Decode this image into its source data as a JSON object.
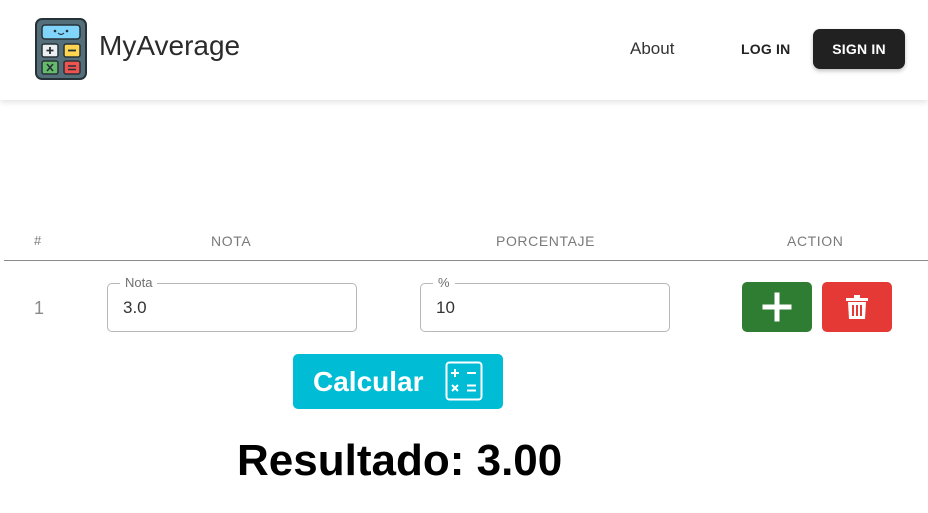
{
  "header": {
    "brand": "MyAverage",
    "logo_icon": "calculator-icon",
    "nav": {
      "about": "About",
      "login": "LOG IN",
      "signin": "SIGN IN"
    }
  },
  "table": {
    "columns": [
      "#",
      "NOTA",
      "PORCENTAJE",
      "ACTION"
    ],
    "rows": [
      {
        "index": "1",
        "nota_label": "Nota",
        "nota_value": "3.0",
        "pct_label": "%",
        "pct_value": "10",
        "add_icon": "plus-icon",
        "delete_icon": "trash-icon"
      }
    ]
  },
  "calculate": {
    "label": "Calcular",
    "icon": "calculator-operations-icon"
  },
  "result": {
    "prefix": "Resultado:",
    "value": "3.00"
  },
  "colors": {
    "add": "#2e7d32",
    "delete": "#e53935",
    "calculate": "#00bcd4",
    "signin": "#212121"
  }
}
